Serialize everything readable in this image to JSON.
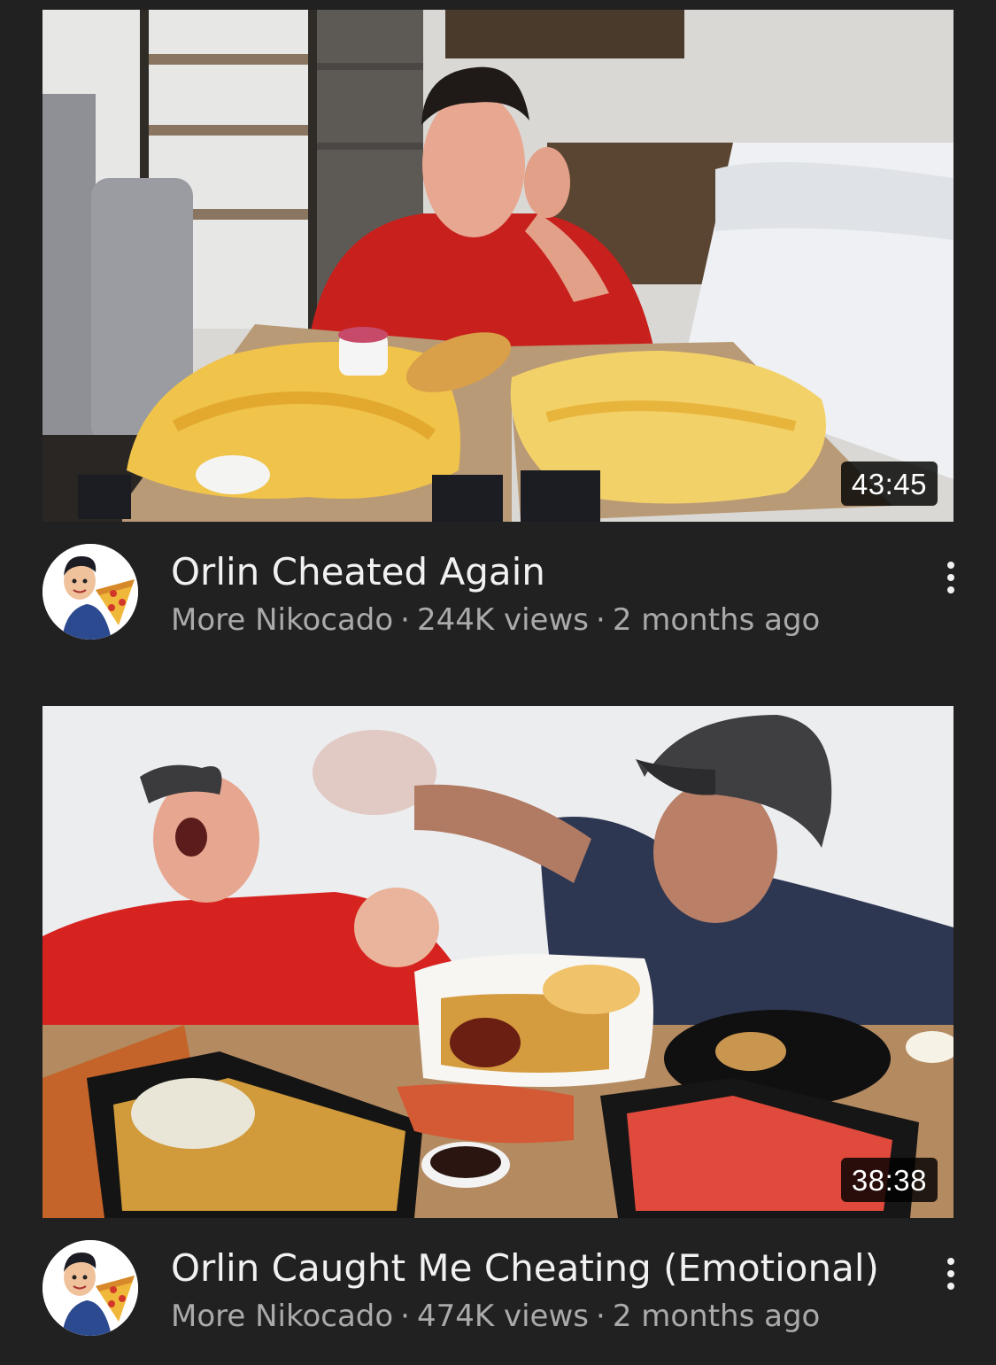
{
  "videos": [
    {
      "title": "Orlin Cheated Again",
      "channel": "More Nikocado",
      "views": "244K views",
      "age": "2 months ago",
      "duration": "43:45",
      "separator": "·",
      "menu_icon": "more-vert-icon"
    },
    {
      "title": "Orlin Caught Me Cheating (Emotional)",
      "channel": "More Nikocado",
      "views": "474K views",
      "age": "2 months ago",
      "duration": "38:38",
      "separator": "·",
      "menu_icon": "more-vert-icon"
    }
  ],
  "colors": {
    "background": "#212121",
    "title_text": "#f1f1f1",
    "meta_text": "#aaaaaa",
    "duration_bg": "#000000"
  }
}
